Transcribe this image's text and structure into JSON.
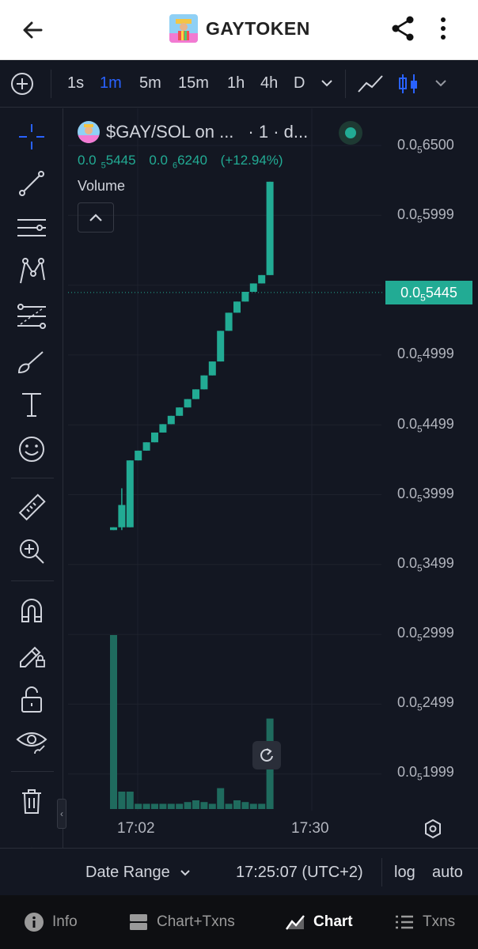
{
  "app_bar": {
    "title": "GAYTOKEN",
    "back_icon": "arrow-left-icon",
    "share_icon": "share-icon",
    "more_icon": "more-vertical-icon"
  },
  "toolbar": {
    "intervals": [
      "1s",
      "1m",
      "5m",
      "15m",
      "1h",
      "4h",
      "D"
    ],
    "active_interval": "1m"
  },
  "legend": {
    "pair": "$GAY/SOL on ...",
    "interval": "· 1 · d...",
    "price_prefix": "0.0",
    "price_sub": "5",
    "price_rest": "5445",
    "change_prefix": "0.0",
    "change_sub": "6",
    "change_rest": "6240",
    "change_pct": "(+12.94%)",
    "volume_label": "Volume"
  },
  "y_axis": {
    "labels": [
      {
        "prefix": "0.0",
        "sub": "5",
        "rest": "6500"
      },
      {
        "prefix": "0.0",
        "sub": "5",
        "rest": "5999"
      },
      {
        "prefix": "0.0",
        "sub": "5",
        "rest": "4999"
      },
      {
        "prefix": "0.0",
        "sub": "5",
        "rest": "4499"
      },
      {
        "prefix": "0.0",
        "sub": "5",
        "rest": "3999"
      },
      {
        "prefix": "0.0",
        "sub": "5",
        "rest": "3499"
      },
      {
        "prefix": "0.0",
        "sub": "5",
        "rest": "2999"
      },
      {
        "prefix": "0.0",
        "sub": "5",
        "rest": "2499"
      },
      {
        "prefix": "0.0",
        "sub": "5",
        "rest": "1999"
      }
    ],
    "current_price": {
      "prefix": "0.0",
      "sub": "5",
      "rest": "5445"
    }
  },
  "x_axis": {
    "labels": [
      "17:02",
      "17:30"
    ]
  },
  "bottom_bar": {
    "date_range": "Date Range",
    "timezone": "17:25:07 (UTC+2)",
    "log": "log",
    "auto": "auto"
  },
  "nav": {
    "items": [
      {
        "label": "Info",
        "icon": "info-icon"
      },
      {
        "label": "Chart+Txns",
        "icon": "split-view-icon"
      },
      {
        "label": "Chart",
        "icon": "chart-icon"
      },
      {
        "label": "Txns",
        "icon": "list-icon"
      }
    ],
    "active": "Chart"
  },
  "colors": {
    "up": "#22ab94",
    "volume": "#1f6b5e",
    "accent": "#2962ff",
    "background": "#131722"
  },
  "chart_data": {
    "type": "candlestick",
    "title": "",
    "price_unit_note": "",
    "ylim": [
      1.999e-06,
      6.5e-06
    ],
    "candles": [
      {
        "open": 3.74e-06,
        "close": 3.76e-06,
        "high": 3.76e-06,
        "low": 3.74e-06
      },
      {
        "open": 3.76e-06,
        "close": 3.92e-06,
        "high": 4.04e-06,
        "low": 3.74e-06
      },
      {
        "open": 3.76e-06,
        "close": 4.24e-06,
        "high": 4.24e-06,
        "low": 3.76e-06
      },
      {
        "open": 4.24e-06,
        "close": 4.31e-06,
        "high": 4.31e-06,
        "low": 4.24e-06
      },
      {
        "open": 4.31e-06,
        "close": 4.37e-06,
        "high": 4.37e-06,
        "low": 4.31e-06
      },
      {
        "open": 4.37e-06,
        "close": 4.44e-06,
        "high": 4.44e-06,
        "low": 4.37e-06
      },
      {
        "open": 4.44e-06,
        "close": 4.5e-06,
        "high": 4.5e-06,
        "low": 4.44e-06
      },
      {
        "open": 4.5e-06,
        "close": 4.56e-06,
        "high": 4.56e-06,
        "low": 4.5e-06
      },
      {
        "open": 4.56e-06,
        "close": 4.62e-06,
        "high": 4.62e-06,
        "low": 4.56e-06
      },
      {
        "open": 4.62e-06,
        "close": 4.68e-06,
        "high": 4.68e-06,
        "low": 4.62e-06
      },
      {
        "open": 4.68e-06,
        "close": 4.75e-06,
        "high": 4.75e-06,
        "low": 4.68e-06
      },
      {
        "open": 4.75e-06,
        "close": 4.85e-06,
        "high": 4.85e-06,
        "low": 4.75e-06
      },
      {
        "open": 4.85e-06,
        "close": 4.95e-06,
        "high": 4.95e-06,
        "low": 4.85e-06
      },
      {
        "open": 4.95e-06,
        "close": 5.17e-06,
        "high": 5.17e-06,
        "low": 4.95e-06
      },
      {
        "open": 5.17e-06,
        "close": 5.3e-06,
        "high": 5.3e-06,
        "low": 5.17e-06
      },
      {
        "open": 5.3e-06,
        "close": 5.38e-06,
        "high": 5.38e-06,
        "low": 5.3e-06
      },
      {
        "open": 5.38e-06,
        "close": 5.45e-06,
        "high": 5.45e-06,
        "low": 5.38e-06
      },
      {
        "open": 5.45e-06,
        "close": 5.51e-06,
        "high": 5.51e-06,
        "low": 5.45e-06
      },
      {
        "open": 5.51e-06,
        "close": 5.57e-06,
        "high": 5.57e-06,
        "low": 5.51e-06
      },
      {
        "open": 5.57e-06,
        "close": 6.24e-06,
        "high": 6.24e-06,
        "low": 5.57e-06
      }
    ],
    "volume": [
      100,
      10,
      10,
      3,
      3,
      3,
      3,
      3,
      3,
      4,
      5,
      4,
      3,
      12,
      3,
      5,
      4,
      3,
      3,
      52
    ]
  }
}
